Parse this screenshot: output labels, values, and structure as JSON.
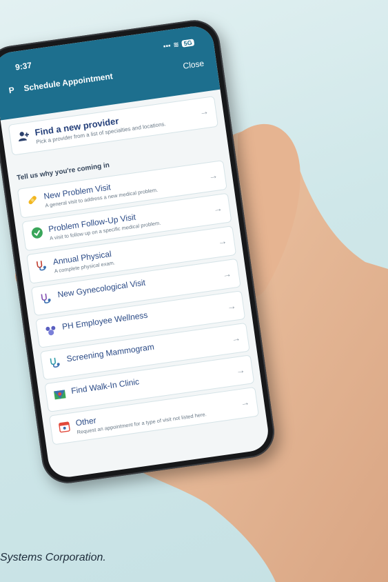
{
  "status_bar": {
    "time": "9:37",
    "signal": "▪▪▪",
    "wifi": "≋",
    "battery": "5G"
  },
  "header": {
    "initial": "P",
    "title": "Schedule Appointment",
    "close_label": "Close"
  },
  "provider_card": {
    "title": "Find a new provider",
    "description": "Pick a provider from a list of specialties and locations."
  },
  "section_label": "Tell us why you're coming in",
  "visits": [
    {
      "title": "New Problem Visit",
      "description": "A general visit to address a new medical problem.",
      "icon": "bandage-icon"
    },
    {
      "title": "Problem Follow-Up Visit",
      "description": "A visit to follow up on a specific medical problem.",
      "icon": "check-circle-icon"
    },
    {
      "title": "Annual Physical",
      "description": "A complete physical exam.",
      "icon": "stethoscope-icon"
    },
    {
      "title": "New Gynecological Visit",
      "description": "",
      "icon": "stethoscope-icon"
    },
    {
      "title": "PH Employee Wellness",
      "description": "",
      "icon": "wellness-icon"
    },
    {
      "title": "Screening Mammogram",
      "description": "",
      "icon": "stethoscope-icon"
    },
    {
      "title": "Find Walk-In Clinic",
      "description": "",
      "icon": "map-icon"
    },
    {
      "title": "Other",
      "description": "Request an appointment for a type of visit not listed here.",
      "icon": "calendar-icon"
    }
  ],
  "caption": "Systems Corporation.",
  "colors": {
    "header": "#1d6f8e",
    "card_title": "#2a4a86",
    "background": "#cfe7e9"
  }
}
